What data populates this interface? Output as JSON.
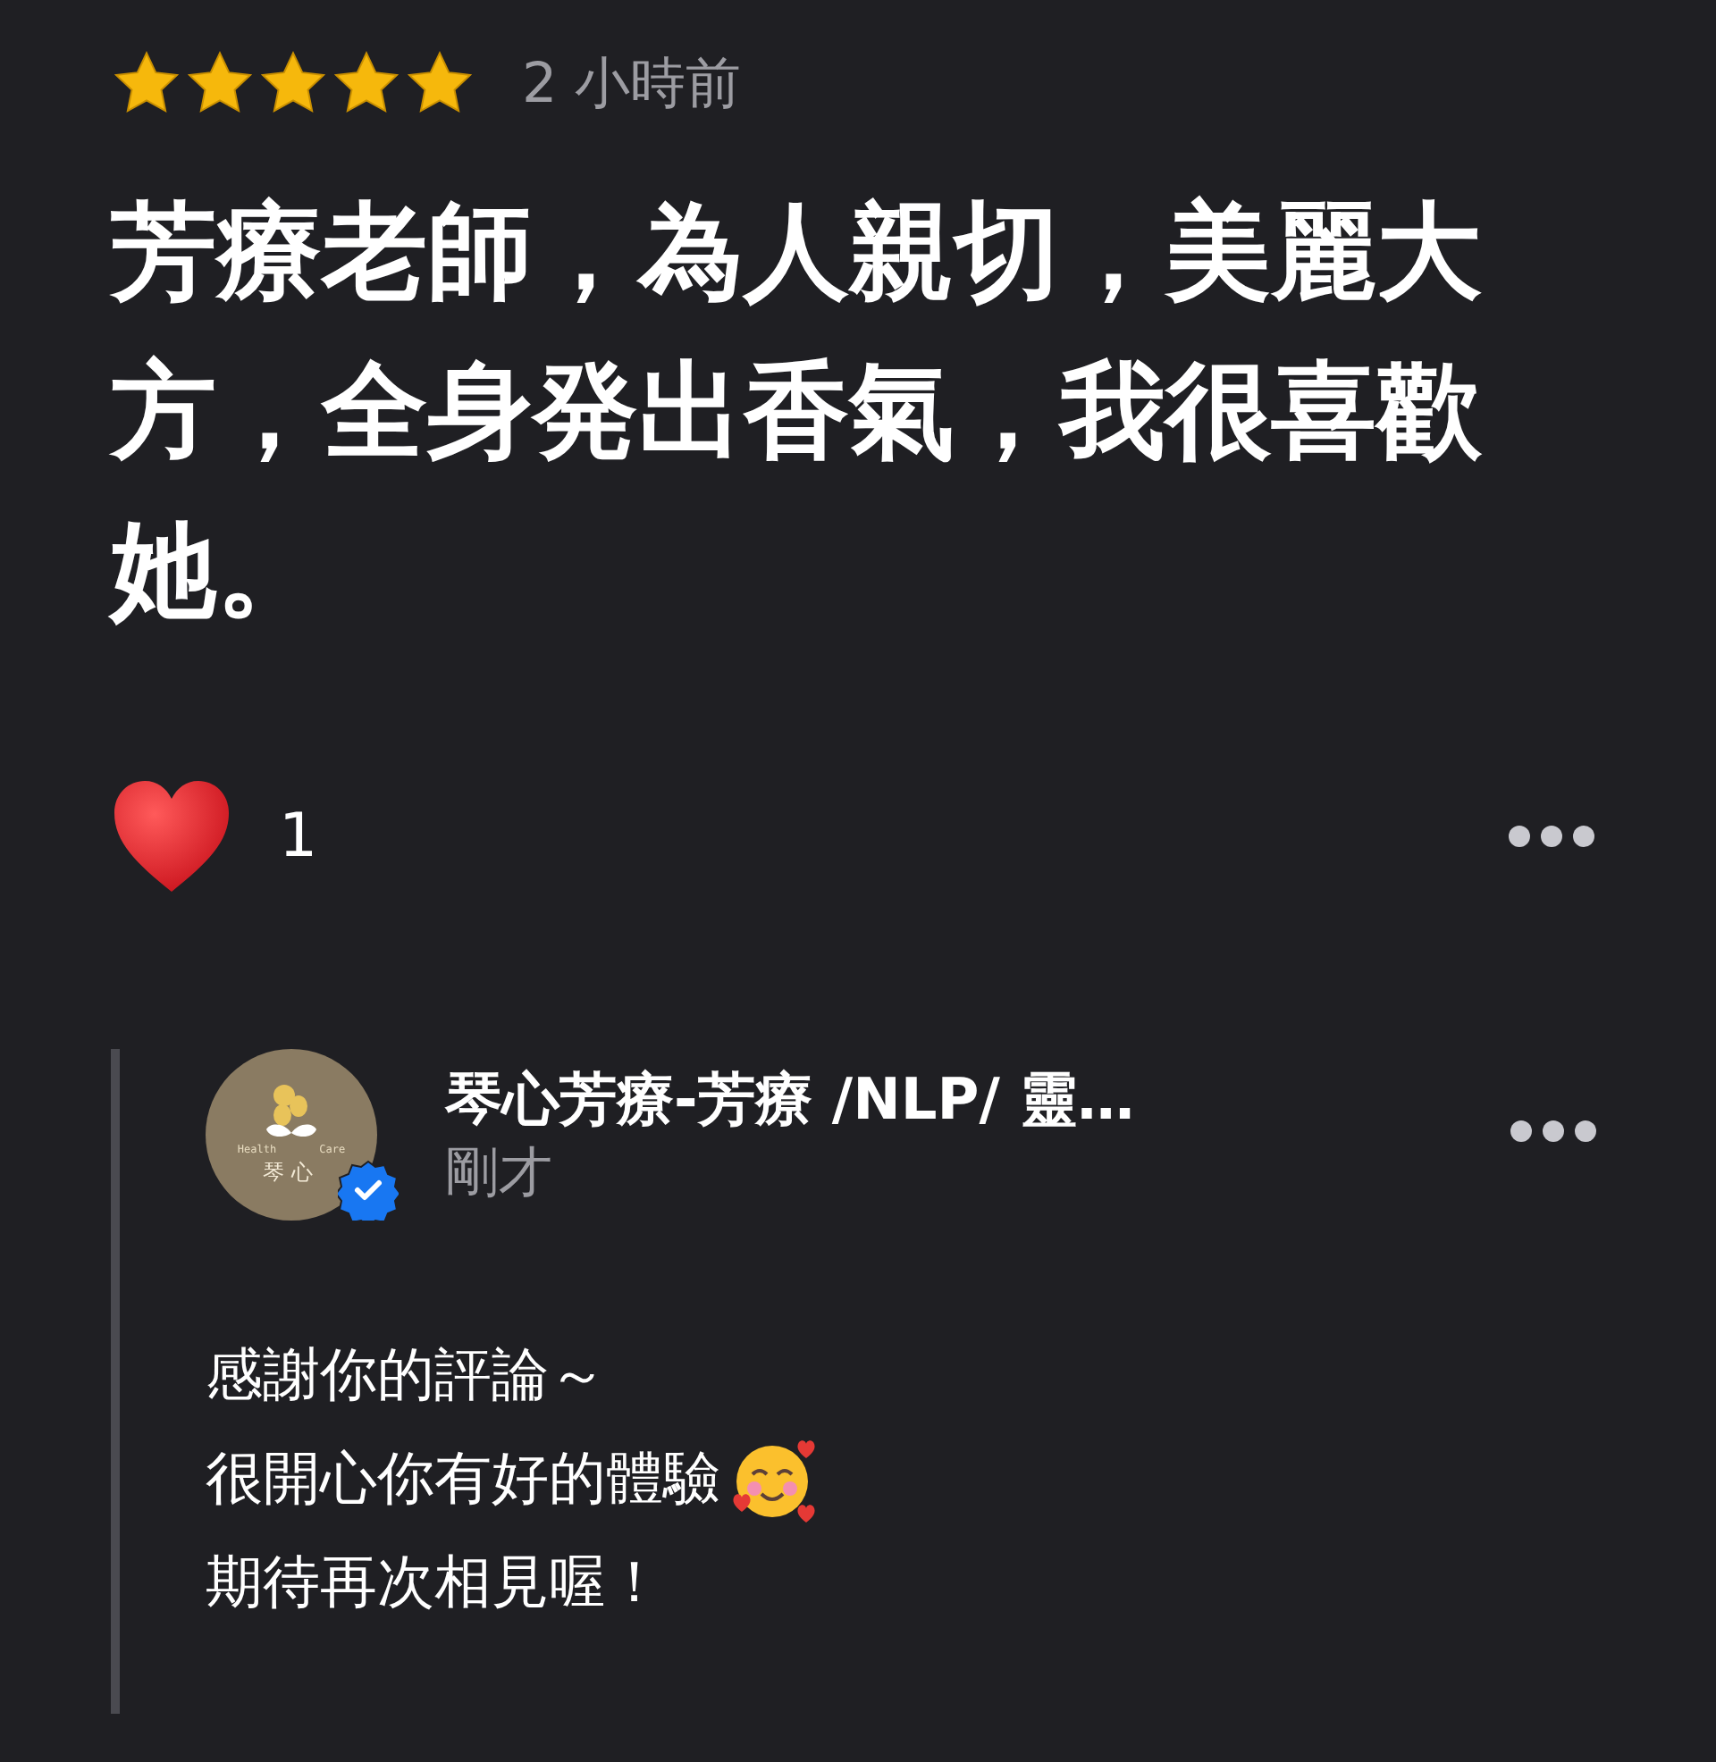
{
  "review": {
    "stars": 5,
    "time": "2 小時前",
    "text": "芳療老師，為人親切，美麗大方，全身発出香氣，我很喜歡她。",
    "reactions": {
      "count": "1"
    }
  },
  "reply": {
    "logo": {
      "left_word": "Health",
      "right_word": "Care",
      "name": "琴心"
    },
    "verified": true,
    "author": "琴心芳療-芳療 /NLP/ 靈…",
    "time": "剛才",
    "lines": [
      "感謝你的評論～",
      "很開心你有好的體驗",
      "期待再次相見喔！"
    ]
  }
}
